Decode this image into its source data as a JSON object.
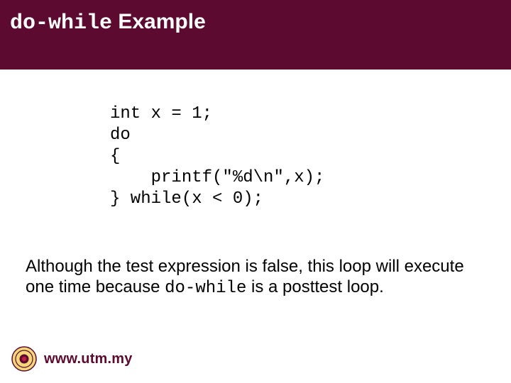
{
  "title": {
    "code_part": "do-while",
    "rest": " Example"
  },
  "code": "int x = 1;\ndo\n{\n    printf(\"%d\\n\",x);\n} while(x < 0);",
  "explain": {
    "pre": "Although the test expression is false, this loop will execute one time because ",
    "code": "do-while",
    "post": " is a posttest loop."
  },
  "footer_url": "www.utm.my"
}
